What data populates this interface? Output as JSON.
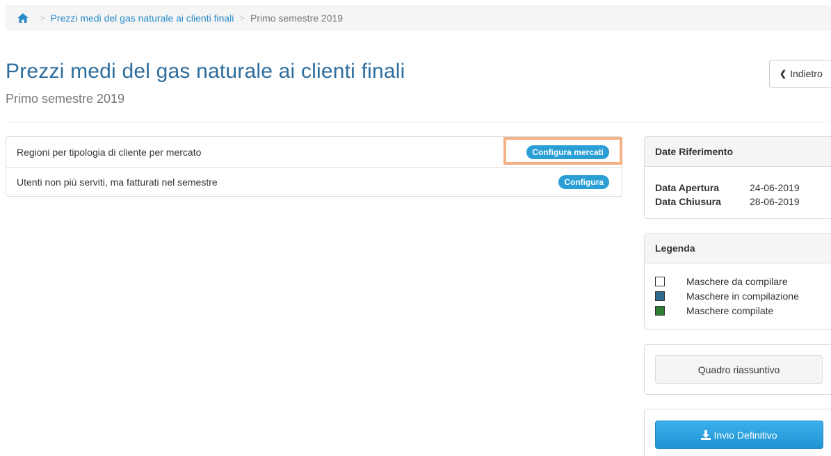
{
  "breadcrumb": {
    "home_icon": "home-icon",
    "separator": ">",
    "link_label": "Prezzi medi del gas naturale ai clienti finali",
    "current_label": "Primo semestre 2019"
  },
  "header": {
    "title": "Prezzi medi del gas naturale ai clienti finali",
    "subtitle": "Primo semestre 2019",
    "back_icon": "chevron-left-icon",
    "back_label": "Indietro"
  },
  "masks": [
    {
      "label": "Regioni per tipologia di cliente per mercato",
      "action_label": "Configura mercati"
    },
    {
      "label": "Utenti non più serviti, ma fatturati nel semestre",
      "action_label": "Configura"
    }
  ],
  "date_panel": {
    "heading": "Date Riferimento",
    "opening_label": "Data Apertura",
    "opening_value": "24-06-2019",
    "closing_label": "Data Chiusura",
    "closing_value": "28-06-2019"
  },
  "legend": {
    "heading": "Legenda",
    "items": [
      {
        "label": "Maschere da compilare",
        "color": "#ffffff"
      },
      {
        "label": "Maschere in compilazione",
        "color": "#2e6b8f"
      },
      {
        "label": "Maschere compilate",
        "color": "#2e7d32"
      }
    ]
  },
  "summary": {
    "label": "Quadro riassuntivo"
  },
  "submit": {
    "label": "Invio Definitivo",
    "icon": "download-icon"
  },
  "colors": {
    "accent": "#2a9fd6",
    "title": "#2e6e9e",
    "highlight": "#f4b183"
  }
}
